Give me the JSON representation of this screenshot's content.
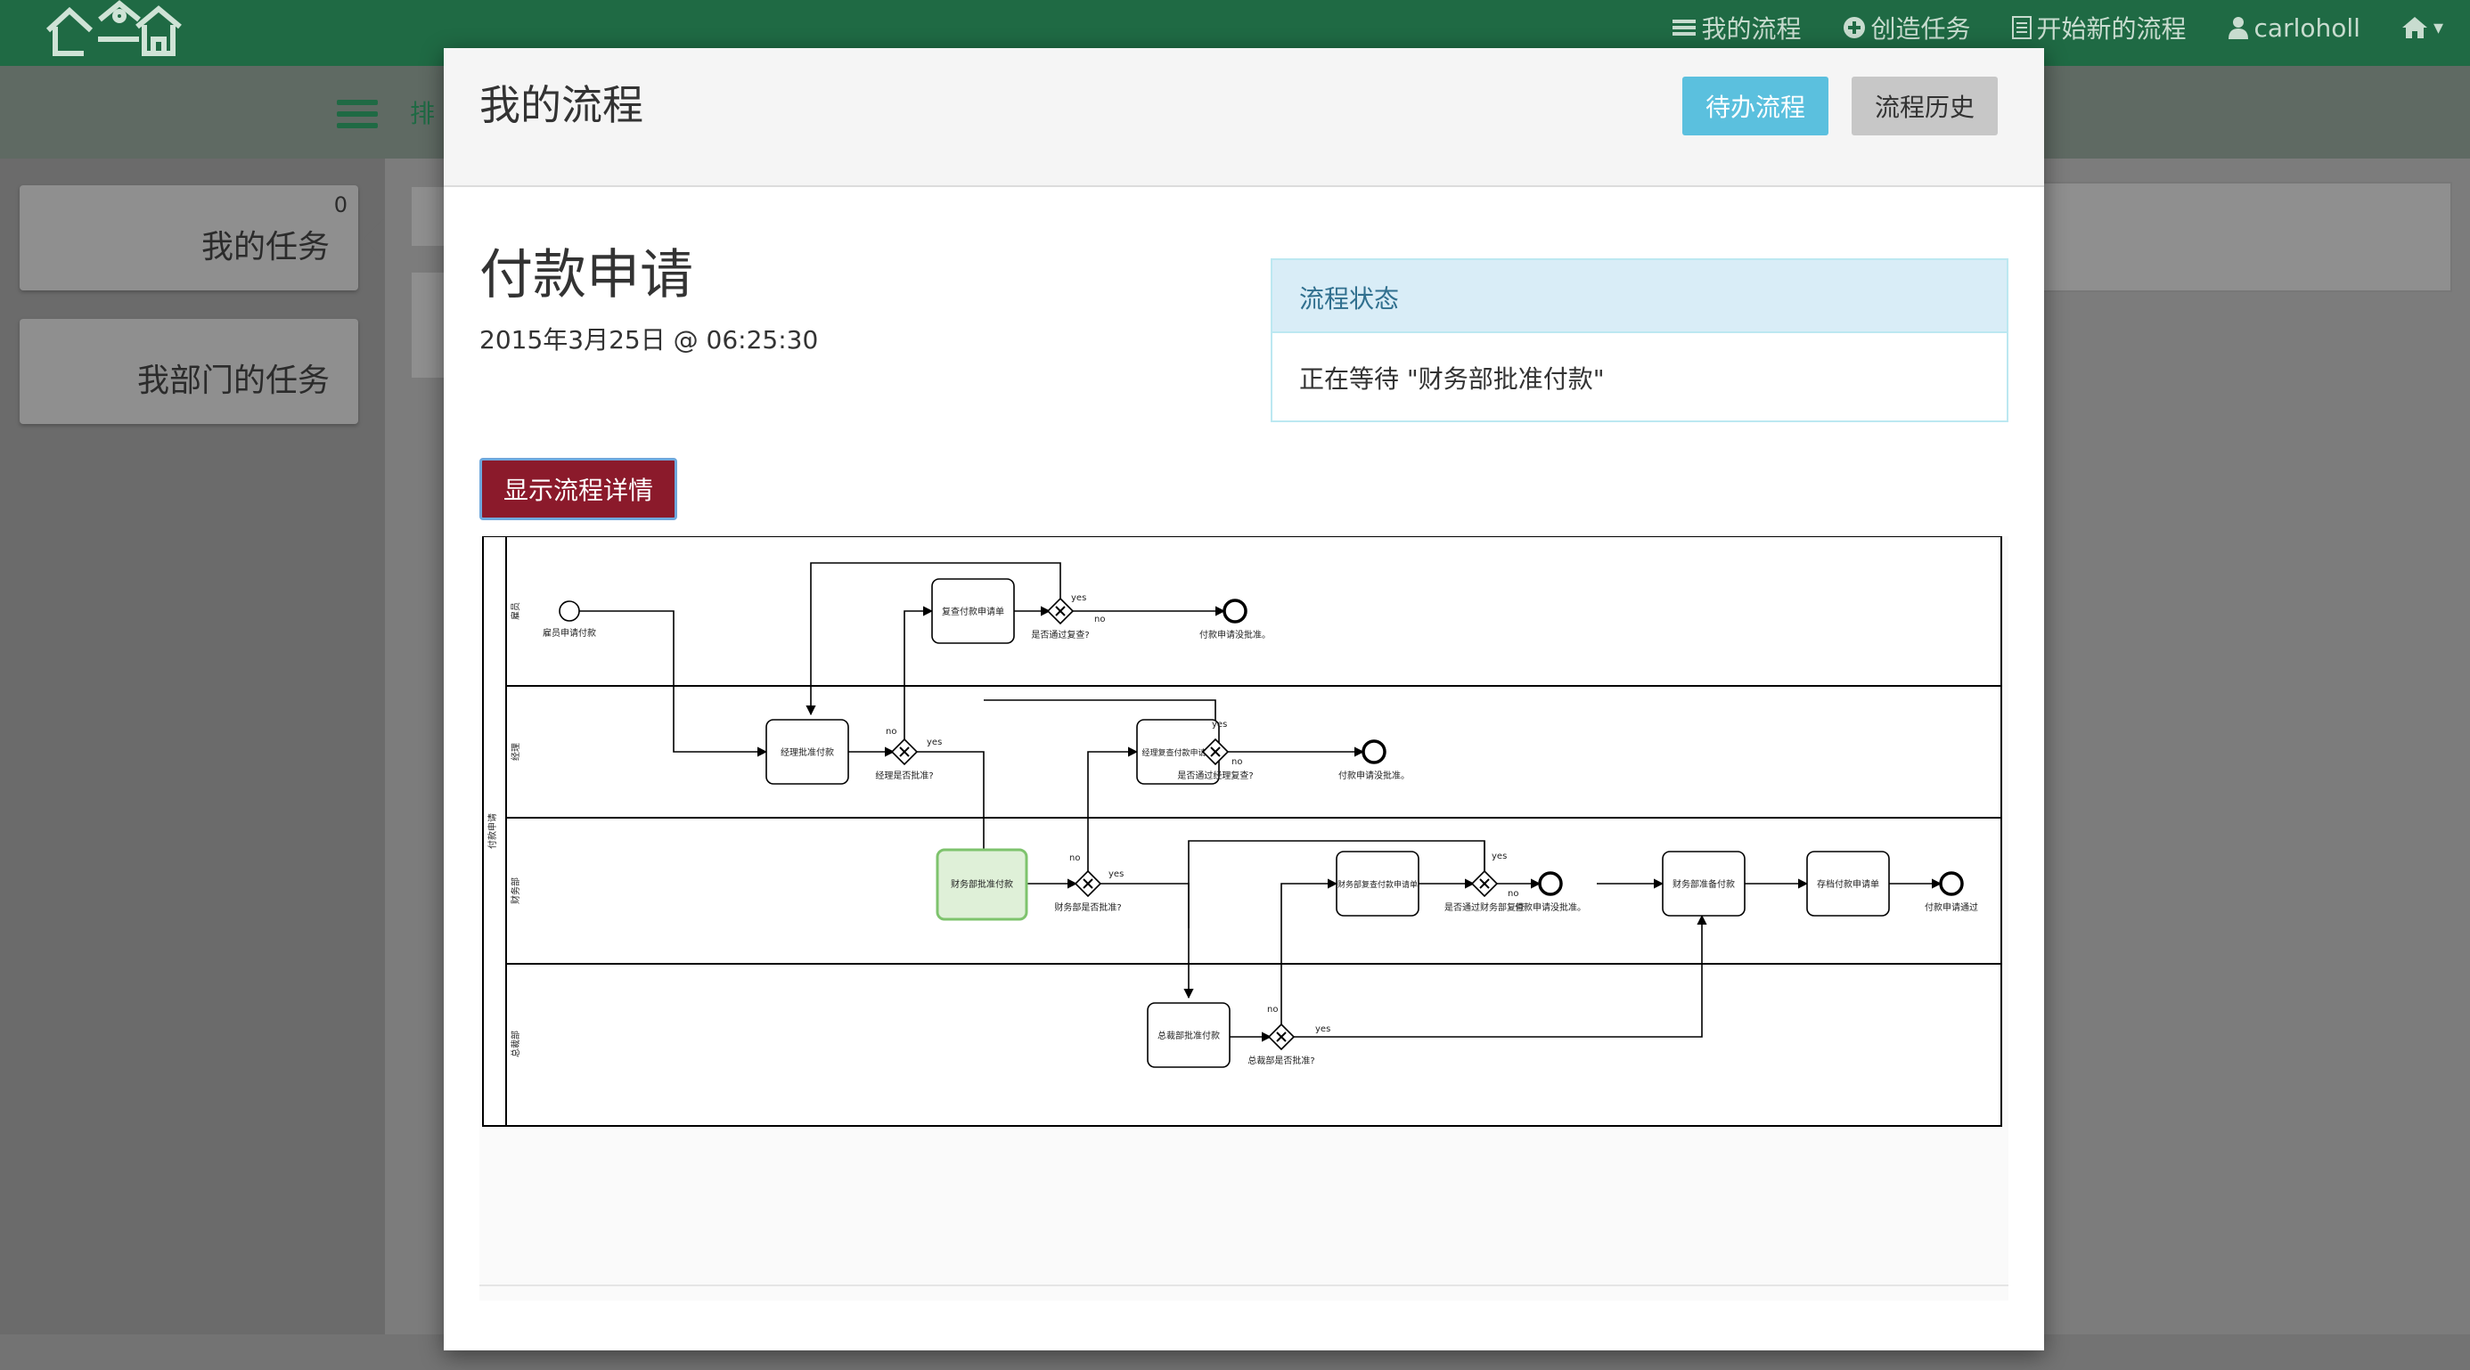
{
  "nav": {
    "items": [
      {
        "icon": "list-icon",
        "label": "我的流程"
      },
      {
        "icon": "plus-circle-icon",
        "label": "创造任务"
      },
      {
        "icon": "document-icon",
        "label": "开始新的流程"
      },
      {
        "icon": "user-icon",
        "label": "carloholl"
      },
      {
        "icon": "home-icon",
        "label": "▾"
      }
    ]
  },
  "subbar": {
    "text": "排"
  },
  "sidebar": {
    "items": [
      {
        "label": "我的任务",
        "count": "0"
      },
      {
        "label": "我部门的任务"
      }
    ]
  },
  "modal": {
    "title": "我的流程",
    "tab_todo": "待办流程",
    "tab_history": "流程历史",
    "process_title": "付款申请",
    "date": "2015年3月25日 @ 06:25:30",
    "status_heading": "流程状态",
    "status_text": "正在等待 \"财务部批准付款\"",
    "detail_button": "显示流程详情"
  },
  "diagram": {
    "pool": "付款申请",
    "lanes": [
      "雇员",
      "经理",
      "财务部",
      "总裁部"
    ],
    "tasks": {
      "t_review": "复查付款申请单",
      "t_mgr": "经理批准付款",
      "t_mgr_review": "经理复查付款申请单",
      "t_fin": "财务部批准付款",
      "t_fin_review": "财务部复查付款申请单",
      "t_fin_prepare": "财务部准备付款",
      "t_archive": "存档付款申请单",
      "t_ceo": "总裁部批准付款"
    },
    "events": {
      "start": "雇员申请付款",
      "end1": "付款申请没批准。",
      "end2": "付款申请没批准。",
      "end3": "付款申请没批准。",
      "end4": "付款申请通过"
    },
    "gateways": {
      "g1": "是否通过复查?",
      "g2": "经理是否批准?",
      "g3": "是否通过经理复查?",
      "g4": "财务部是否批准?",
      "g5": "是否通过财务部复查",
      "g6": "总裁部是否批准?"
    },
    "flow_labels": {
      "yes": "yes",
      "no": "no"
    },
    "active_task": "财务部批准付款",
    "active_color": "#dff0d8"
  }
}
